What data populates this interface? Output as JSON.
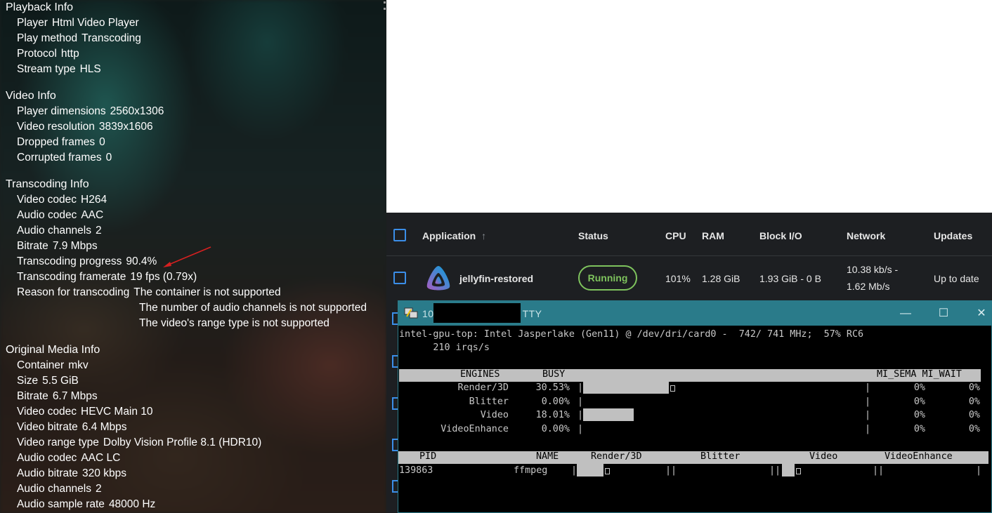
{
  "playback": {
    "sections": [
      {
        "title": "Playback Info",
        "rows": [
          {
            "label": "Player",
            "value": "Html Video Player"
          },
          {
            "label": "Play method",
            "value": "Transcoding"
          },
          {
            "label": "Protocol",
            "value": "http"
          },
          {
            "label": "Stream type",
            "value": "HLS"
          }
        ]
      },
      {
        "title": "Video Info",
        "rows": [
          {
            "label": "Player dimensions",
            "value": "2560x1306"
          },
          {
            "label": "Video resolution",
            "value": "3839x1606"
          },
          {
            "label": "Dropped frames",
            "value": "0"
          },
          {
            "label": "Corrupted frames",
            "value": "0"
          }
        ]
      },
      {
        "title": "Transcoding Info",
        "rows": [
          {
            "label": "Video codec",
            "value": "H264"
          },
          {
            "label": "Audio codec",
            "value": "AAC"
          },
          {
            "label": "Audio channels",
            "value": "2"
          },
          {
            "label": "Bitrate",
            "value": "7.9 Mbps"
          },
          {
            "label": "Transcoding progress",
            "value": "90.4%"
          },
          {
            "label": "Transcoding framerate",
            "value": "19 fps (0.79x)"
          },
          {
            "label": "Reason for transcoding",
            "value": "The container is not supported"
          }
        ],
        "reason_extra": [
          "The number of audio channels is not supported",
          "The video's range type is not supported"
        ]
      },
      {
        "title": "Original Media Info",
        "rows": [
          {
            "label": "Container",
            "value": "mkv"
          },
          {
            "label": "Size",
            "value": "5.5 GiB"
          },
          {
            "label": "Bitrate",
            "value": "6.7 Mbps"
          },
          {
            "label": "Video codec",
            "value": "HEVC Main 10"
          },
          {
            "label": "Video bitrate",
            "value": "6.4 Mbps"
          },
          {
            "label": "Video range type",
            "value": "Dolby Vision Profile 8.1 (HDR10)"
          },
          {
            "label": "Audio codec",
            "value": "AAC LC"
          },
          {
            "label": "Audio bitrate",
            "value": "320 kbps"
          },
          {
            "label": "Audio channels",
            "value": "2"
          },
          {
            "label": "Audio sample rate",
            "value": "48000 Hz"
          }
        ]
      }
    ],
    "arrow_color": "#d62020"
  },
  "apps_table": {
    "headers": {
      "application": "Application",
      "sort_glyph": "↑",
      "status": "Status",
      "cpu": "CPU",
      "ram": "RAM",
      "block_io": "Block I/O",
      "network": "Network",
      "updates": "Updates"
    },
    "row": {
      "name": "jellyfin-restored",
      "status": "Running",
      "cpu": "101%",
      "ram": "1.28 GiB",
      "block_io": "1.93 GiB - 0 B",
      "network_in": "10.38 kb/s -",
      "network_out": "1.62 Mb/s",
      "updates": "Up to date"
    },
    "colors": {
      "accent": "#3b8ee8",
      "running": "#7ec35d",
      "background": "#1d1f22"
    }
  },
  "putty": {
    "title_prefix": "10",
    "title_suffix": "TTY",
    "minimize_glyph": "—",
    "maximize_glyph": "☐",
    "close_glyph": "✕",
    "header_line1": "intel-gpu-top: Intel Jasperlake (Gen11) @ /dev/dri/card0 -  742/ 741 MHz;  57% RC6",
    "header_line2": "      210 irqs/s",
    "engines_header": {
      "engines": "ENGINES",
      "busy": "BUSY",
      "mi": "MI_SEMA MI_WAIT"
    },
    "engines": [
      {
        "name": "Render/3D",
        "busy": "30.53%",
        "busy_value": 30.53,
        "sema": "0%",
        "wait": "0%"
      },
      {
        "name": "Blitter",
        "busy": "0.00%",
        "busy_value": 0.0,
        "sema": "0%",
        "wait": "0%"
      },
      {
        "name": "Video",
        "busy": "18.01%",
        "busy_value": 18.01,
        "sema": "0%",
        "wait": "0%"
      },
      {
        "name": "VideoEnhance",
        "busy": "0.00%",
        "busy_value": 0.0,
        "sema": "0%",
        "wait": "0%"
      }
    ],
    "proc_header": {
      "pid": "PID",
      "name": "NAME",
      "render": "Render/3D",
      "blitter": "Blitter",
      "video": "Video",
      "enhance": "VideoEnhance"
    },
    "process": {
      "pid": "139863",
      "name": "ffmpeg"
    },
    "colors": {
      "titlebar": "#2a7b8a",
      "cursor": "#2ee62e"
    }
  }
}
